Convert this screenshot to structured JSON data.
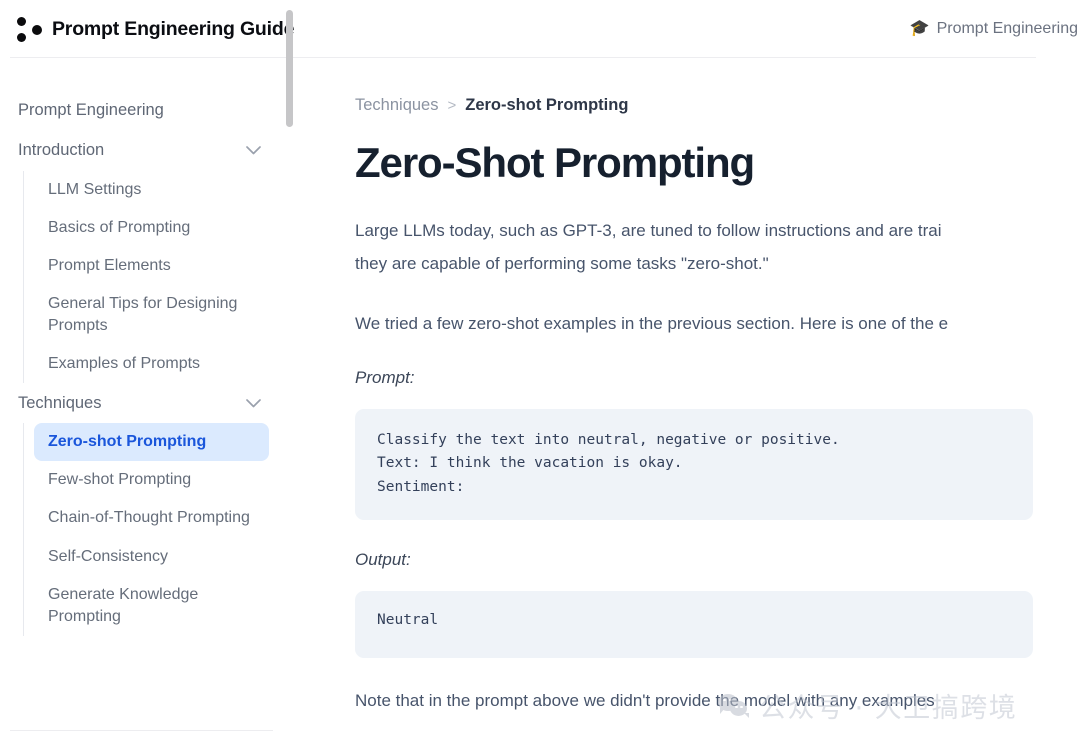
{
  "header": {
    "logo_icon": "three-dots-logo",
    "brand_title": "Prompt Engineering Guide",
    "right_link_icon": "graduation-cap-icon",
    "right_link_label": "Prompt Engineering C"
  },
  "sidebar": {
    "groups": [
      {
        "label": "Prompt Engineering",
        "has_chevron": false,
        "chevron": "",
        "items": []
      },
      {
        "label": "Introduction",
        "has_chevron": true,
        "chevron": "⌄",
        "items": [
          {
            "label": "LLM Settings",
            "active": false
          },
          {
            "label": "Basics of Prompting",
            "active": false
          },
          {
            "label": "Prompt Elements",
            "active": false
          },
          {
            "label": "General Tips for Designing Prompts",
            "active": false
          },
          {
            "label": "Examples of Prompts",
            "active": false
          }
        ]
      },
      {
        "label": "Techniques",
        "has_chevron": true,
        "chevron": "⌄",
        "items": [
          {
            "label": "Zero-shot Prompting",
            "active": true
          },
          {
            "label": "Few-shot Prompting",
            "active": false
          },
          {
            "label": "Chain-of-Thought Prompting",
            "active": false
          },
          {
            "label": "Self-Consistency",
            "active": false
          },
          {
            "label": "Generate Knowledge Prompting",
            "active": false
          }
        ]
      }
    ],
    "active_bg_color": "#dbeafe",
    "active_text_color": "#1a56db"
  },
  "main": {
    "breadcrumb": {
      "parent": "Techniques",
      "separator": ">",
      "current": "Zero-shot Prompting"
    },
    "title": "Zero-Shot Prompting",
    "paragraph_1": "Large LLMs today, such as GPT-3, are tuned to follow instructions and are trai",
    "paragraph_1b": "they are capable of performing some tasks \"zero-shot.\"",
    "paragraph_2": "We tried a few zero-shot examples in the previous section. Here is one of the e",
    "prompt_label": "Prompt:",
    "prompt_code": "Classify the text into neutral, negative or positive.\nText: I think the vacation is okay.\nSentiment:",
    "output_label": "Output:",
    "output_code": "Neutral",
    "paragraph_3": "Note that in the prompt above we didn't provide the model with any examples"
  },
  "watermark": {
    "icon": "wechat-logo-icon",
    "text": "公众号 · 大卫搞跨境"
  }
}
